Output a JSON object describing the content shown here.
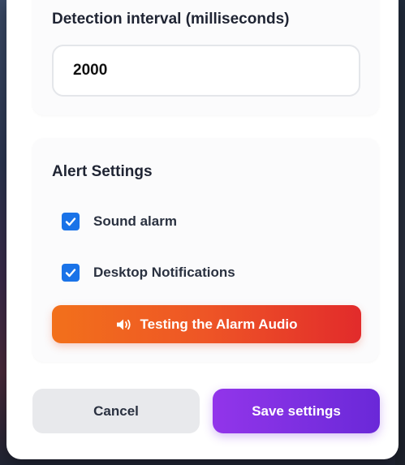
{
  "detection": {
    "label": "Detection interval (milliseconds)",
    "value": "2000"
  },
  "alert_settings": {
    "title": "Alert Settings",
    "options": [
      {
        "label": "Sound alarm",
        "checked": true
      },
      {
        "label": "Desktop Notifications",
        "checked": true
      }
    ],
    "test_button_label": "Testing the Alarm Audio",
    "test_button_icon": "speaker-icon"
  },
  "actions": {
    "cancel_label": "Cancel",
    "save_label": "Save settings"
  },
  "colors": {
    "checkbox": "#1a73e8",
    "alarm_gradient_start": "#f2701b",
    "alarm_gradient_end": "#e22b2b",
    "save_gradient_start": "#9235ea",
    "save_gradient_end": "#6a28d8",
    "cancel_bg": "#e8e9ec"
  }
}
